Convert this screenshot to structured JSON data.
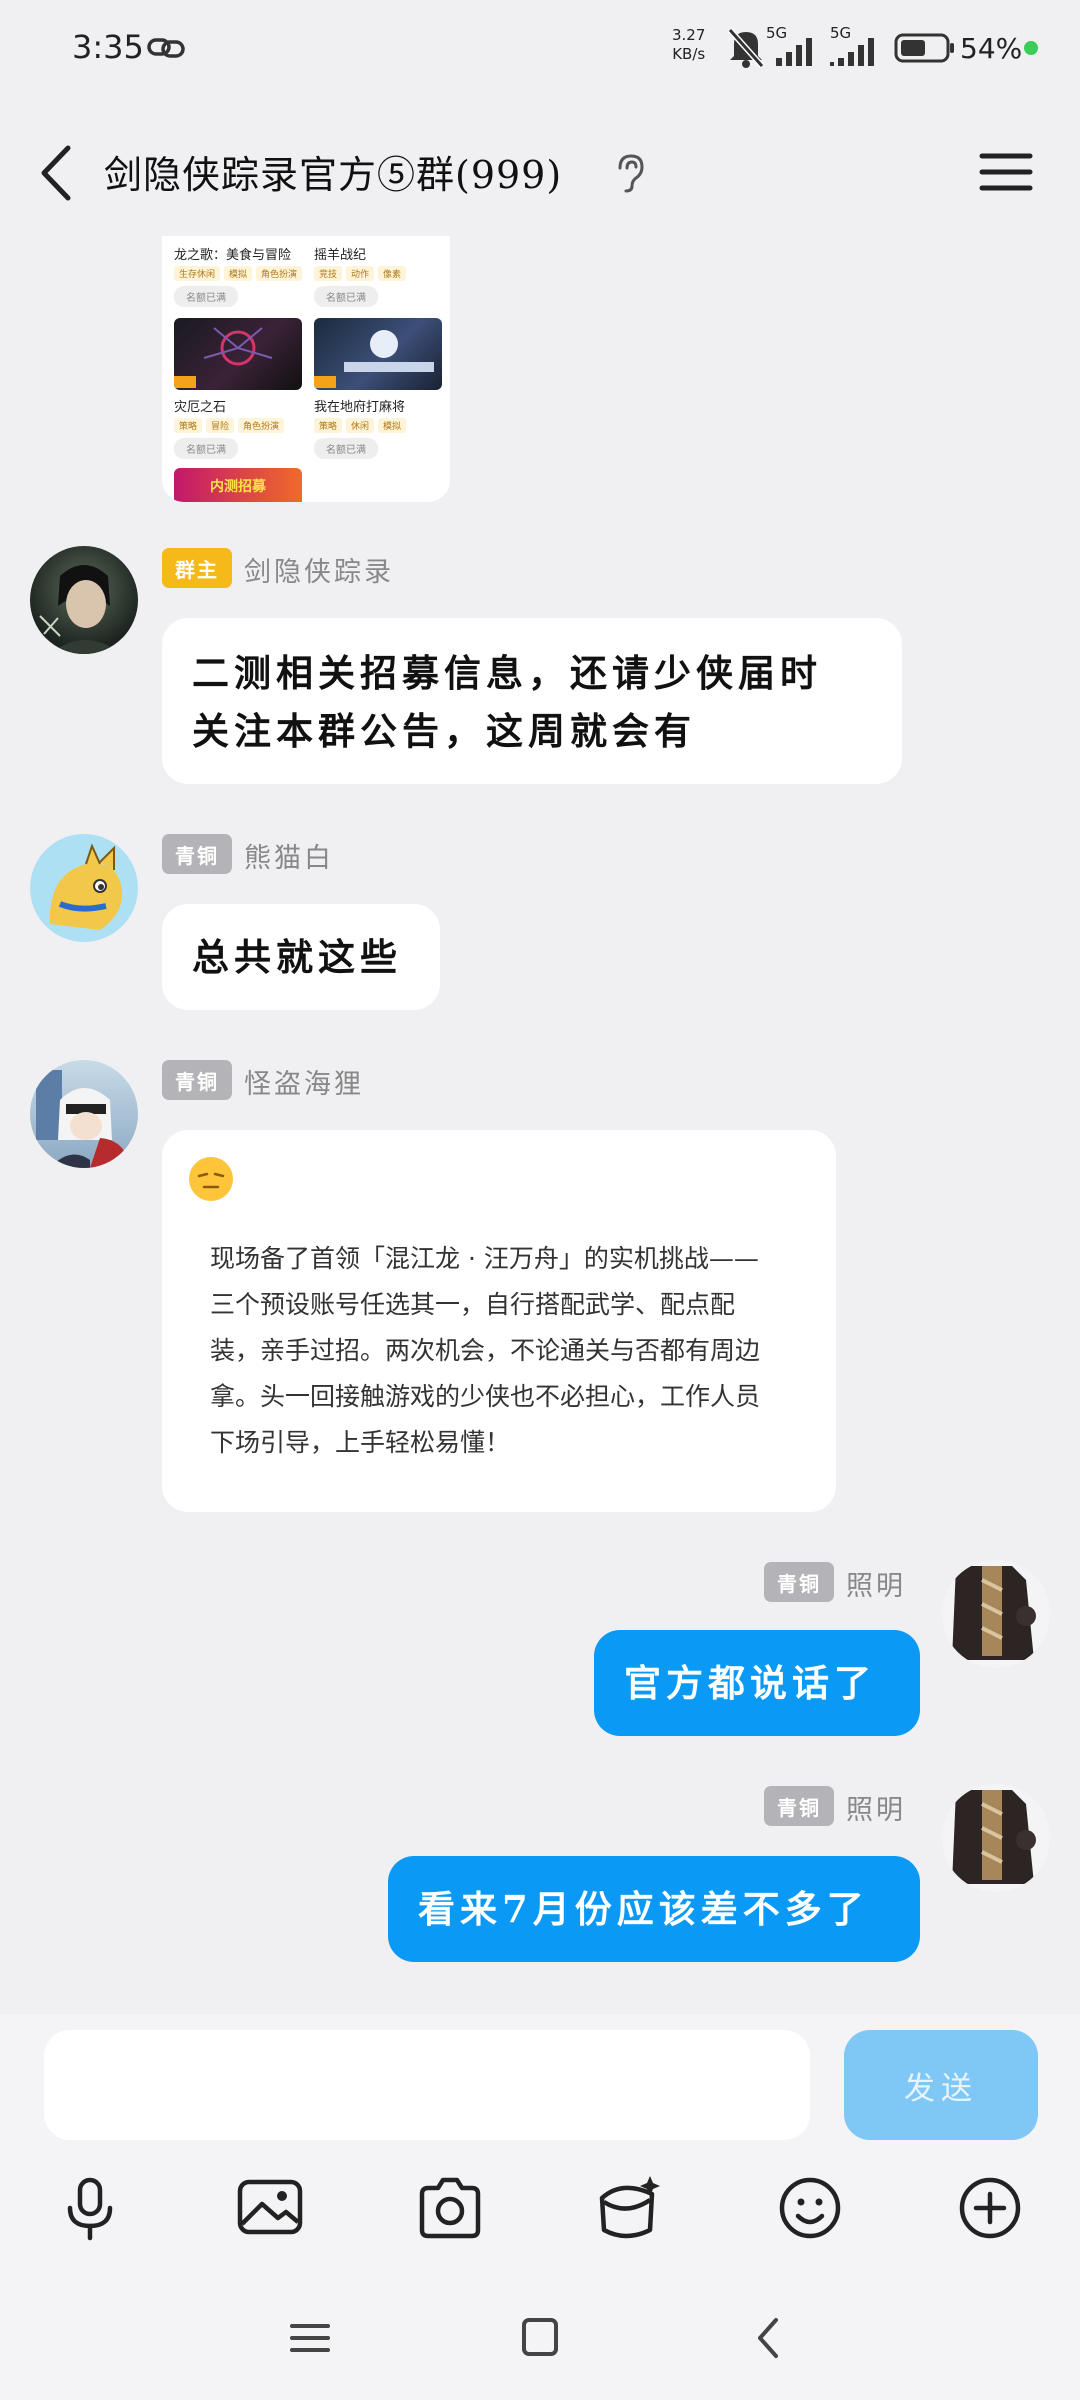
{
  "status_bar": {
    "time": "3:35",
    "net_speed_value": "3.27",
    "net_speed_unit": "KB/s",
    "signal_1": "5G",
    "signal_2": "5G",
    "battery": "54%"
  },
  "header": {
    "title": "剑隐侠踪录官方⑤群(999)",
    "back_icon": "chevron-left-icon",
    "ear_icon": "ear-icon",
    "menu_icon": "hamburger-menu-icon"
  },
  "game_card": {
    "games": [
      {
        "title": "龙之歌：美食与冒险",
        "tags": [
          "生存休闲",
          "模拟",
          "角色扮演"
        ],
        "button": "名额已满"
      },
      {
        "title": "摇羊战纪",
        "tags": [
          "竞技",
          "动作",
          "像素"
        ],
        "button": "名额已满"
      },
      {
        "title": "灾厄之石",
        "tags": [
          "策略",
          "冒险",
          "角色扮演"
        ],
        "button": "名额已满"
      },
      {
        "title": "我在地府打麻将",
        "tags": [
          "策略",
          "休闲",
          "模拟"
        ],
        "button": "名额已满"
      }
    ],
    "banner_text": "内测招募"
  },
  "messages": [
    {
      "badge": "群主",
      "sender": "剑隐侠踪录",
      "lines": [
        "二测相关招募信息，还请少侠届时",
        "关注本群公告，这周就会有"
      ]
    },
    {
      "badge": "青铜",
      "sender": "熊猫白",
      "lines": [
        "总共就这些"
      ]
    },
    {
      "badge": "青铜",
      "sender": "怪盗海狸",
      "emoji": "😑",
      "lines": [
        "现场备了首领「混江龙 · 汪万舟」的实机挑战——",
        "三个预设账号任选其一，自行搭配武学、配点配",
        "装，亲手过招。两次机会，不论通关与否都有周边",
        "拿。头一回接触游戏的少侠也不必担心，工作人员",
        "下场引导，上手轻松易懂！"
      ]
    },
    {
      "badge": "青铜",
      "sender": "照明",
      "lines": [
        "官方都说话了"
      ]
    },
    {
      "badge": "青铜",
      "sender": "照明",
      "lines": [
        "看来7月份应该差不多了"
      ]
    }
  ],
  "input": {
    "placeholder": "",
    "send_label": "发送"
  },
  "toolbar": [
    "microphone-icon",
    "image-icon",
    "camera-icon",
    "red-packet-icon",
    "emoji-icon",
    "plus-icon"
  ],
  "nav_bar": [
    "menu-nav-icon",
    "home-nav-icon",
    "back-nav-icon"
  ],
  "colors": {
    "background": "#f0f0f3",
    "my_bubble": "#0a99f5",
    "owner_badge": "#f6b91a",
    "bronze_badge": "#b4b4b8",
    "send_button": "#7fc8f6"
  }
}
